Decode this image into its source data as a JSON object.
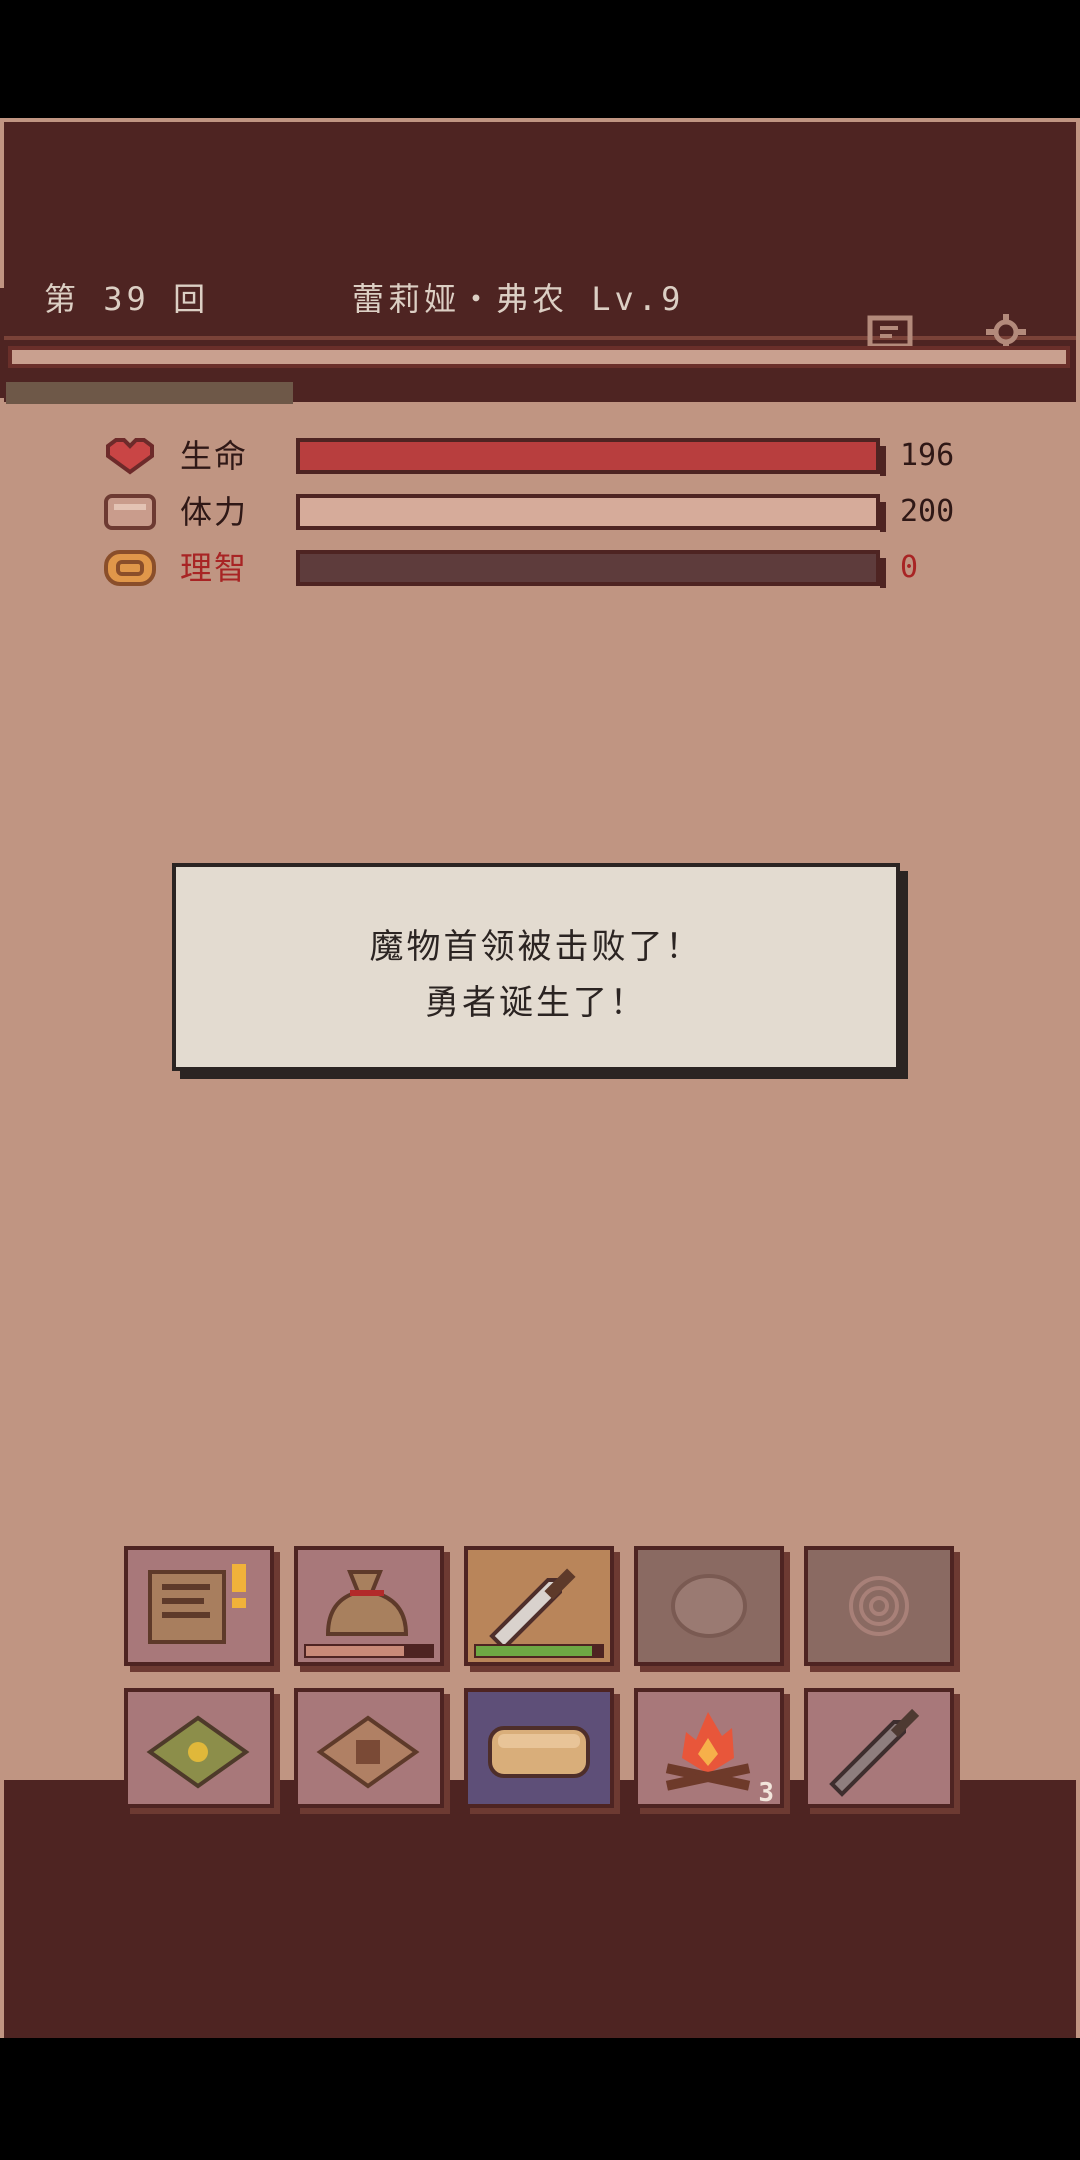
{
  "header": {
    "round": "第 39 回",
    "hero": "蕾莉娅・弗农 Lv.9",
    "icons": [
      "journal-icon",
      "settings-icon"
    ]
  },
  "stats": [
    {
      "id": "hp",
      "label": "生命",
      "value": "196",
      "fill": 1.0,
      "color": "#b83e3e",
      "label_color": "#2f1816",
      "icon": "heart-icon"
    },
    {
      "id": "stamina",
      "label": "体力",
      "value": "200",
      "fill": 1.0,
      "color": "#d6ab9a",
      "label_color": "#2f1816",
      "icon": "stamina-icon"
    },
    {
      "id": "sanity",
      "label": "理智",
      "value": "0",
      "fill": 0.0,
      "color": "#5e3c3c",
      "label_color": "#a82424",
      "icon": "brain-icon"
    }
  ],
  "xp_progress": 0.27,
  "dialog": {
    "line1": "魔物首领被击败了！",
    "line2": "勇者诞生了！"
  },
  "inventory_row1": [
    {
      "icon": "quest-scroll-icon",
      "state": "normal",
      "badge": "!"
    },
    {
      "icon": "loot-bag-icon",
      "state": "normal",
      "progress": 0.78,
      "bar_color": "#c88a78"
    },
    {
      "icon": "sword-icon",
      "state": "active",
      "progress": 0.92,
      "bar_color": "#6ea844"
    },
    {
      "icon": "shield-slot-icon",
      "state": "disabled"
    },
    {
      "icon": "accessory-slot-icon",
      "state": "disabled"
    }
  ],
  "inventory_row2": [
    {
      "icon": "spellbook-icon",
      "state": "normal"
    },
    {
      "icon": "recipe-book-icon",
      "state": "normal"
    },
    {
      "icon": "bread-icon",
      "state": "selected"
    },
    {
      "icon": "campfire-icon",
      "state": "normal",
      "count": "3"
    },
    {
      "icon": "dagger-icon",
      "state": "normal"
    }
  ],
  "colors": {
    "background": "#c09582",
    "dark_panel": "#4e2422",
    "slot_normal": "#a8787a",
    "slot_active": "#b9855a",
    "slot_selected": "#5e4f78",
    "slot_disabled": "#8a6a62"
  }
}
